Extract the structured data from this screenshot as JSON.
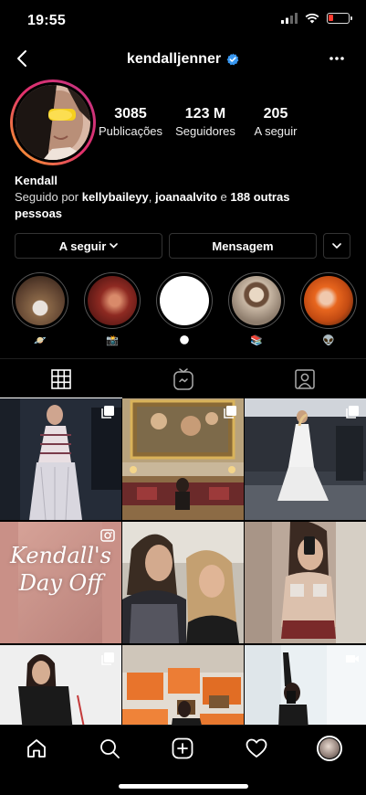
{
  "status": {
    "time": "19:55",
    "battery_level": 0.25,
    "battery_color": "#ff3b30",
    "icons": [
      "signal-icon",
      "wifi-icon",
      "battery-icon"
    ]
  },
  "header": {
    "username": "kendalljenner",
    "verified": true,
    "verified_color": "#3897f0",
    "icons": [
      "back-arrow-icon",
      "more-dots-icon"
    ]
  },
  "profile": {
    "stats": [
      {
        "value": "3085",
        "label": "Publicações"
      },
      {
        "value": "123 M",
        "label": "Seguidores"
      },
      {
        "value": "205",
        "label": "A seguir"
      }
    ],
    "name": "Kendall",
    "followed_prefix": "Seguido por",
    "followed_user1": "kellybaileyy",
    "followed_sep": ",",
    "followed_user2": "joanaalvito",
    "followed_and": "e",
    "followed_others": "188 outras",
    "followed_suffix": "pessoas"
  },
  "actions": {
    "following_label": "A seguir",
    "message_label": "Mensagem"
  },
  "highlights": [
    {
      "label": "🪐",
      "icon": "planet-emoji"
    },
    {
      "label": "📸",
      "icon": "camera-emoji"
    },
    {
      "label": "🌑",
      "icon": "new-moon-emoji"
    },
    {
      "label": "📚",
      "icon": "books-emoji"
    },
    {
      "label": "👽",
      "icon": "alien-emoji"
    }
  ],
  "tabs": [
    {
      "icon": "grid-icon",
      "active": true
    },
    {
      "icon": "igtv-icon",
      "active": false
    },
    {
      "icon": "tagged-icon",
      "active": false
    }
  ],
  "grid": {
    "overlay_text": "Kendall's Day Off",
    "cells": [
      {
        "badge": "carousel-icon"
      },
      {
        "badge": "carousel-icon"
      },
      {
        "badge": "carousel-icon"
      },
      {
        "badge": "video-icon"
      },
      {
        "badge": "none"
      },
      {
        "badge": "none"
      },
      {
        "badge": "carousel-icon"
      },
      {
        "badge": "none"
      },
      {
        "badge": "video-icon"
      }
    ]
  },
  "tabbar": {
    "icons": [
      "home-icon",
      "search-icon",
      "new-post-icon",
      "heart-icon",
      "profile-avatar"
    ]
  },
  "colors": {
    "background": "#000000",
    "story_ring": [
      "#f9a825",
      "#e1306c",
      "#c13584"
    ]
  }
}
